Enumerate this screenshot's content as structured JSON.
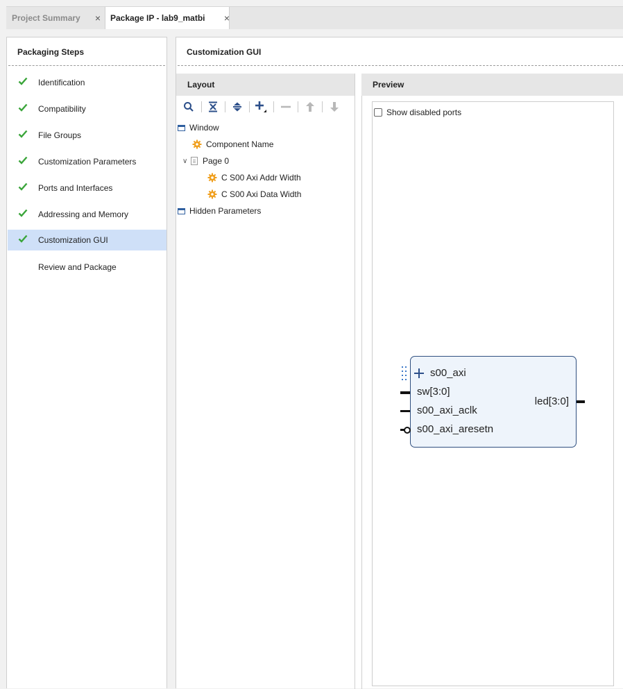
{
  "tabs": [
    {
      "label": "Project Summary",
      "active": false
    },
    {
      "label": "Package IP - lab9_matbi",
      "active": true
    }
  ],
  "packaging_steps": {
    "title": "Packaging Steps",
    "items": [
      {
        "label": "Identification",
        "done": true
      },
      {
        "label": "Compatibility",
        "done": true
      },
      {
        "label": "File Groups",
        "done": true
      },
      {
        "label": "Customization Parameters",
        "done": true
      },
      {
        "label": "Ports and Interfaces",
        "done": true
      },
      {
        "label": "Addressing and Memory",
        "done": true
      },
      {
        "label": "Customization GUI",
        "done": true,
        "selected": true
      },
      {
        "label": "Review and Package",
        "done": false
      }
    ]
  },
  "main": {
    "title": "Customization GUI",
    "layout": {
      "title": "Layout",
      "toolbar": [
        "search-icon",
        "collapse-all-icon",
        "expand-all-icon",
        "add-icon",
        "remove-icon",
        "move-up-icon",
        "move-down-icon"
      ],
      "tree": {
        "window": "Window",
        "component_name": "Component Name",
        "page0": "Page 0",
        "addr_width": "C S00 Axi Addr Width",
        "data_width": "C S00 Axi Data Width",
        "hidden": "Hidden Parameters"
      }
    },
    "preview": {
      "title": "Preview",
      "show_disabled_ports": "Show disabled ports",
      "show_disabled_checked": false,
      "ip_block": {
        "ports_left": [
          "s00_axi",
          "sw[3:0]",
          "s00_axi_aclk",
          "s00_axi_aresetn"
        ],
        "ports_right": [
          "led[3:0]"
        ]
      }
    }
  },
  "colors": {
    "accent_check": "#3aa53a",
    "selection": "#cfe0f8",
    "gear": "#f0a020",
    "ip_fill": "#eef4fb",
    "ip_border": "#2f4f7f"
  }
}
